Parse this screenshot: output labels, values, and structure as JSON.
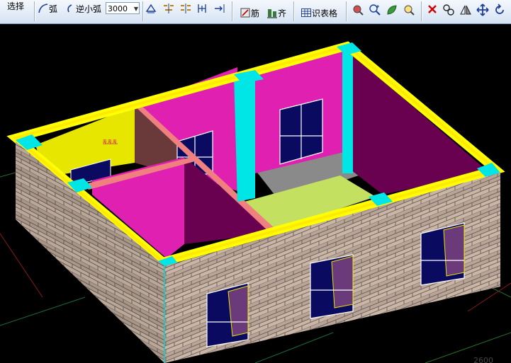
{
  "toolbar": {
    "select_label": "选择",
    "arc_label": "弧",
    "reverse_arc_label": "逆小弧",
    "radius_value": "3000",
    "rebar_label": "筋",
    "align_label": "齐",
    "recognize_table_label": "识表格"
  },
  "scene": {
    "room_label": "乱乱乱",
    "partial_number": "2600"
  },
  "colors": {
    "background": "#000000",
    "wall_top": "#ffff00",
    "column": "#00e5e5",
    "pink_wall": "#e020b0",
    "dark_wall": "#6a0050",
    "yellow_wall": "#e6e600",
    "floor": "#c4e060",
    "brick": "#c8b4a0"
  }
}
